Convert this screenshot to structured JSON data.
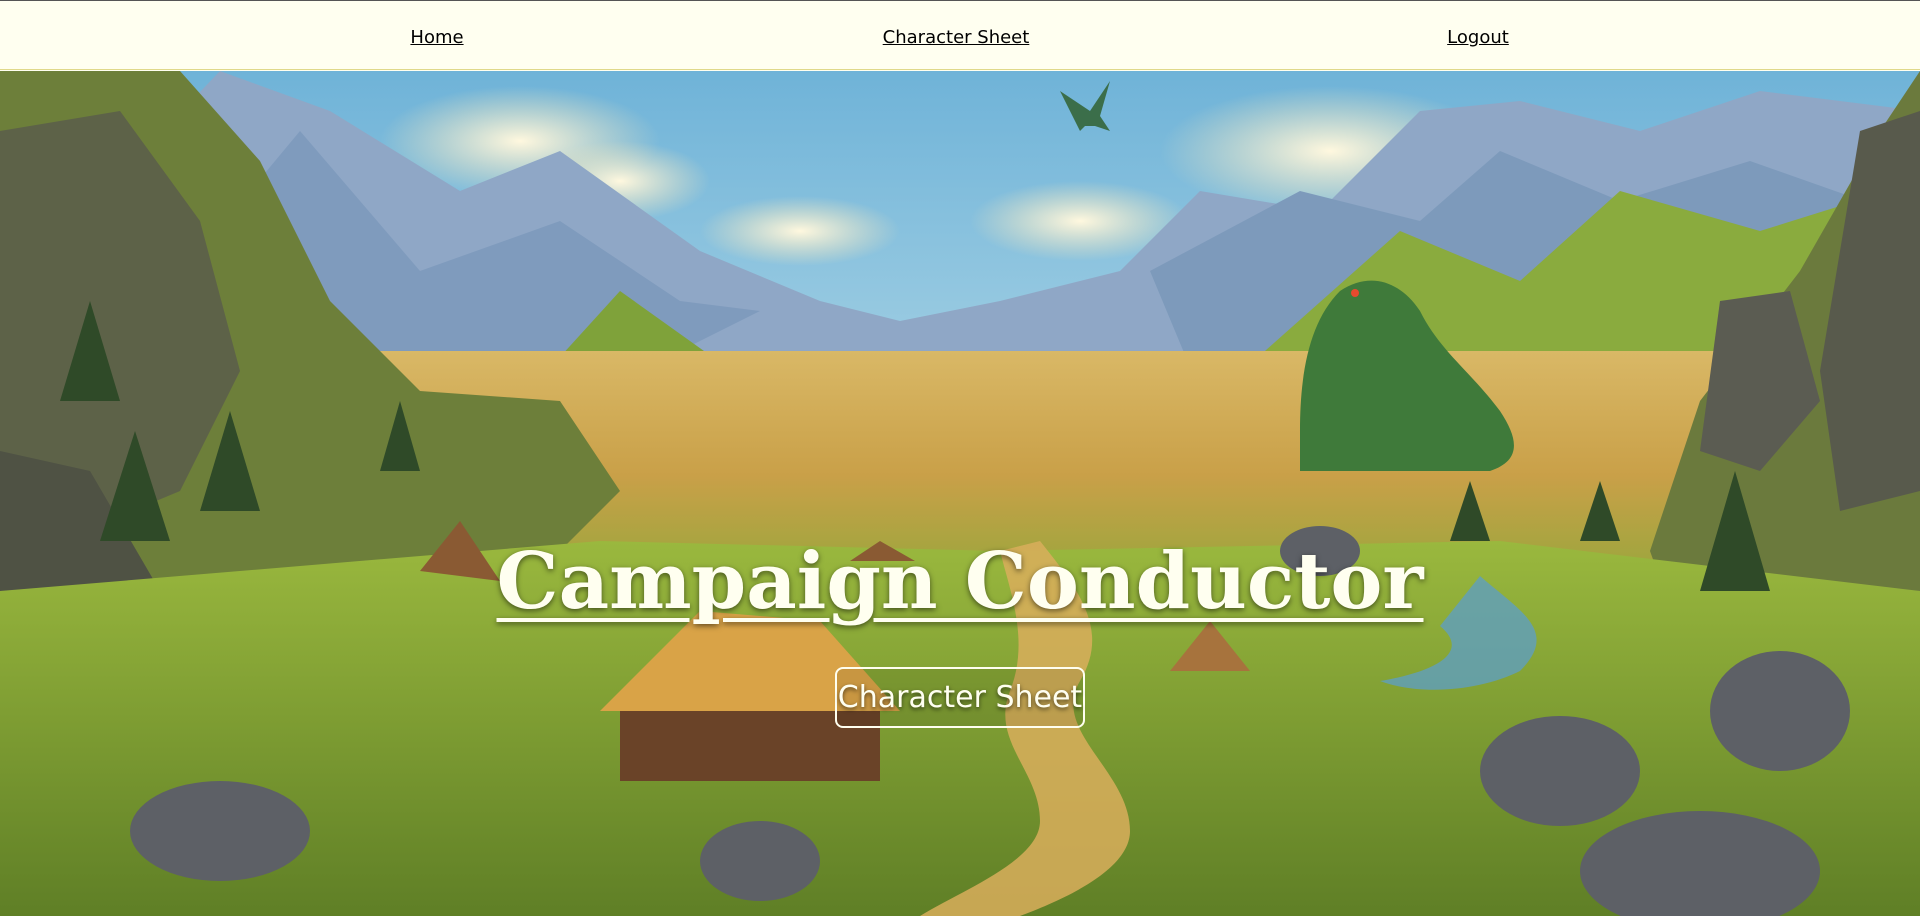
{
  "nav": {
    "home_label": "Home",
    "character_sheet_label": "Character Sheet",
    "logout_label": "Logout"
  },
  "hero": {
    "title": "Campaign Conductor",
    "button_label": "Character Sheet"
  },
  "colors": {
    "nav_background": "#fffff0",
    "hero_text": "#fffff0"
  }
}
